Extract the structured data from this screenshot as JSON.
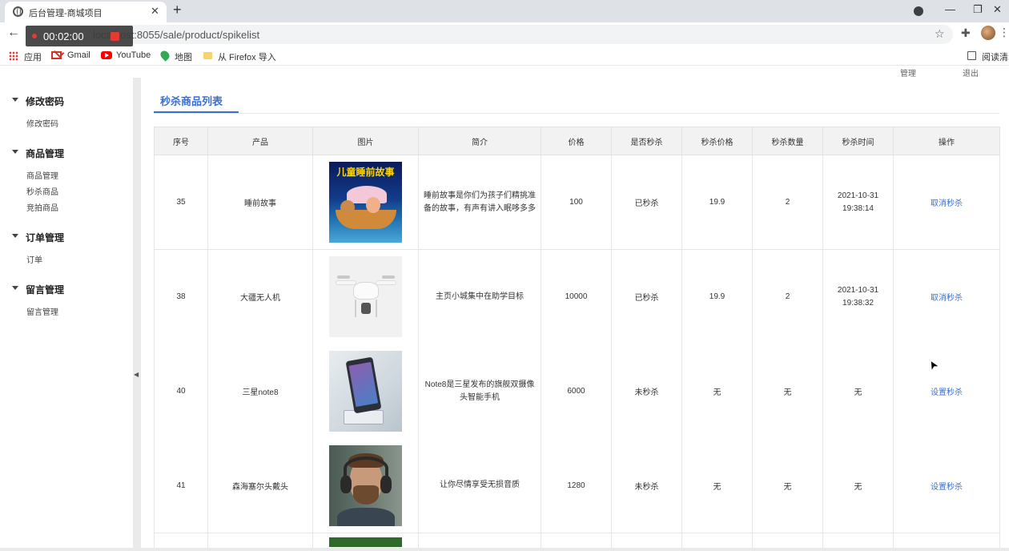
{
  "browser": {
    "tab_title": "后台管理-商城项目",
    "url": "localhost:8055/sale/product/spikelist",
    "recording_time": "00:02:00",
    "bookmarks": [
      "应用",
      "Gmail",
      "YouTube",
      "地图",
      "从 Firefox 导入"
    ],
    "reading_list": "阅读清单"
  },
  "app": {
    "topstrip": [
      "管理",
      "退出"
    ]
  },
  "sidebar": {
    "groups": [
      {
        "title": "修改密码",
        "items": [
          "修改密码"
        ]
      },
      {
        "title": "商品管理",
        "items": [
          "商品管理",
          "秒杀商品",
          "竞拍商品"
        ]
      },
      {
        "title": "订单管理",
        "items": [
          "订单"
        ]
      },
      {
        "title": "留言管理",
        "items": [
          "留言管理"
        ]
      }
    ]
  },
  "content": {
    "tab": "秒杀商品列表",
    "columns": [
      "序号",
      "产品",
      "图片",
      "简介",
      "价格",
      "是否秒杀",
      "秒杀价格",
      "秒杀数量",
      "秒杀时间",
      "操作"
    ],
    "rows": [
      {
        "id": "35",
        "name": "睡前故事",
        "image": "儿童睡前故事",
        "desc": "睡前故事是你们为孩子们精挑准备的故事，有声有讲入眠哆多多",
        "price": "100",
        "spike": "已秒杀",
        "spike_price": "19.9",
        "spike_qty": "2",
        "spike_date": "2021-10-31",
        "spike_time": "19:38:14",
        "action": "取消秒杀"
      },
      {
        "id": "38",
        "name": "大疆无人机",
        "image": "drone",
        "desc": "主页小城集中在助学目标",
        "price": "10000",
        "spike": "已秒杀",
        "spike_price": "19.9",
        "spike_qty": "2",
        "spike_date": "2021-10-31",
        "spike_time": "19:38:32",
        "action": "取消秒杀"
      },
      {
        "id": "40",
        "name": "三星note8",
        "image": "phone",
        "desc": "Note8是三星发布的旗舰双摄像头智能手机",
        "price": "6000",
        "spike": "未秒杀",
        "spike_price": "无",
        "spike_qty": "无",
        "spike_date": "无",
        "spike_time": "",
        "action": "设置秒杀"
      },
      {
        "id": "41",
        "name": "森海塞尔头戴头",
        "image": "headphones",
        "desc": "让你尽情享受无损音质",
        "price": "1280",
        "spike": "未秒杀",
        "spike_price": "无",
        "spike_qty": "无",
        "spike_date": "无",
        "spike_time": "",
        "action": "设置秒杀"
      }
    ]
  },
  "icons": {
    "tab_favicon": "globe-icon",
    "close": "close-icon",
    "new_tab": "plus-icon",
    "back": "arrow-left-icon",
    "star": "star-icon",
    "extensions": "puzzle-icon",
    "collapse": "triangle-left-icon",
    "menu_caret": "caret-down-icon"
  },
  "colors": {
    "accent": "#3b6fd4",
    "header_bg": "#f2f2f2",
    "recording": "#e53935"
  }
}
